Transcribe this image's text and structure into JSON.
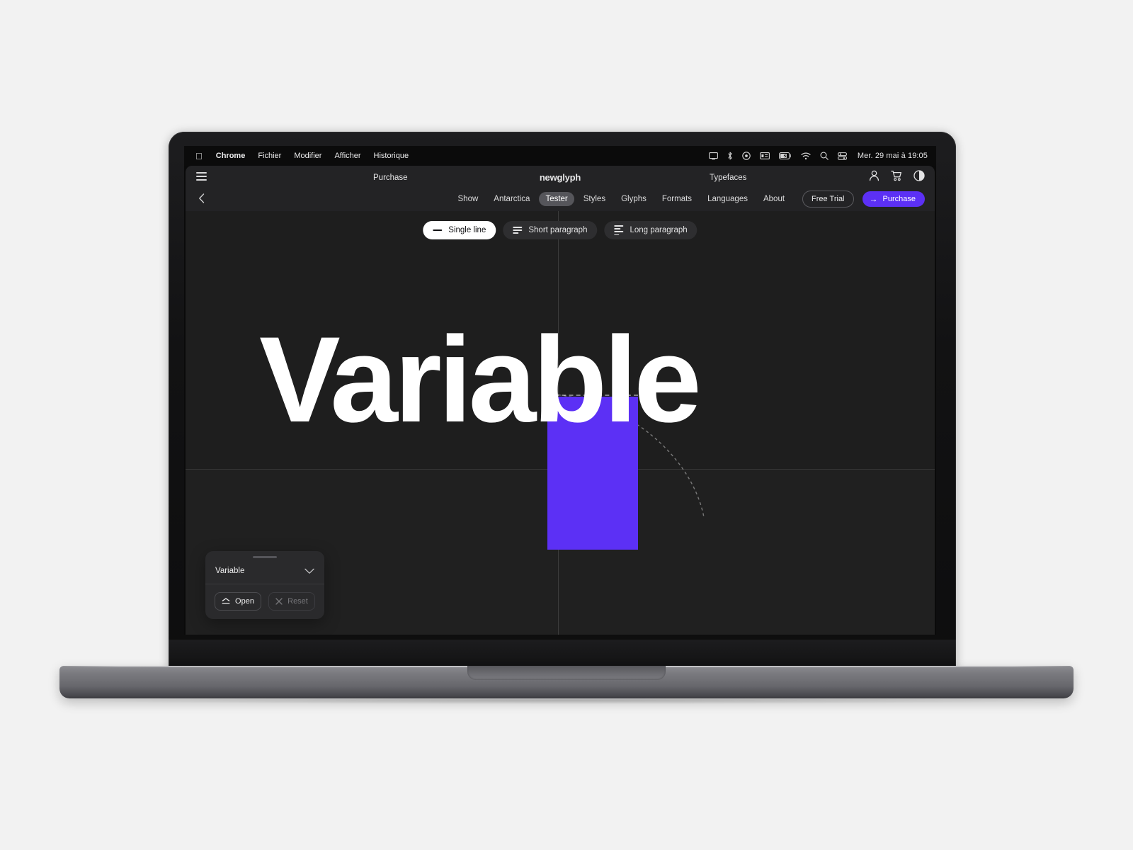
{
  "os_menubar": {
    "apple_icon": "apple-logo-icon",
    "items": [
      {
        "label": "Chrome",
        "bold": true
      },
      {
        "label": "Fichier",
        "bold": false
      },
      {
        "label": "Modifier",
        "bold": false
      },
      {
        "label": "Afficher",
        "bold": false
      },
      {
        "label": "Historique",
        "bold": false
      }
    ],
    "status_icons": [
      "screen-mirroring-icon",
      "bluetooth-icon",
      "control-center-record-icon",
      "battery-widget-icon",
      "battery-charging-icon",
      "wifi-icon",
      "spotlight-search-icon",
      "control-center-icon"
    ],
    "clock": "Mer. 29 mai à 19:05"
  },
  "site_header": {
    "menu_icon": "hamburger-menu-icon",
    "back_icon": "chevron-left-icon",
    "left_label": "Purchase",
    "brand": "newglyph",
    "right_label": "Typefaces",
    "account_icon": "user-account-icon",
    "cart_icon": "shopping-cart-icon",
    "theme_icon": "contrast-theme-icon",
    "subnav": [
      {
        "label": "Show",
        "active": false
      },
      {
        "label": "Antarctica",
        "active": false
      },
      {
        "label": "Tester",
        "active": true
      },
      {
        "label": "Styles",
        "active": false
      },
      {
        "label": "Glyphs",
        "active": false
      },
      {
        "label": "Formats",
        "active": false
      },
      {
        "label": "Languages",
        "active": false
      },
      {
        "label": "About",
        "active": false
      }
    ],
    "free_trial_label": "Free Trial",
    "purchase_label": "Purchase",
    "purchase_arrow": "arrow-right-icon",
    "accent_color": "#5c30f5"
  },
  "tester": {
    "modes": [
      {
        "label": "Single line",
        "icon": "single-line-icon",
        "active": true
      },
      {
        "label": "Short paragraph",
        "icon": "short-paragraph-icon",
        "active": false
      },
      {
        "label": "Long paragraph",
        "icon": "long-paragraph-icon",
        "active": false
      }
    ],
    "sample_text": "Variable",
    "selected_glyph": "a",
    "selection_color": "#5c30f5",
    "text_color": "#ffffff",
    "canvas_background": "#1e1e1e"
  },
  "panel": {
    "grip": "drag-handle",
    "title": "Variable",
    "chevron_icon": "chevron-down-icon",
    "open_label": "Open",
    "open_icon": "expand-open-icon",
    "reset_label": "Reset",
    "reset_icon": "close-x-icon",
    "reset_disabled": true
  }
}
